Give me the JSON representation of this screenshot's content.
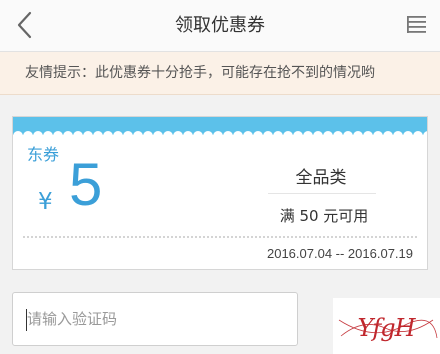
{
  "header": {
    "title": "领取优惠券",
    "back_icon": "chevron-left-icon",
    "menu_icon": "list-menu-icon"
  },
  "tip": {
    "text": "友情提示：此优惠券十分抢手，可能存在抢不到的情况哟"
  },
  "coupon": {
    "brand": "东券",
    "currency": "¥",
    "amount": "5",
    "category": "全品类",
    "condition": "满 50 元可用",
    "validity": "2016.07.04 -- 2016.07.19",
    "accent_color": "#3b9fd8",
    "top_band_color": "#5cc1ea"
  },
  "captcha": {
    "placeholder": "请输入验证码",
    "code_text": "YfgH",
    "code_color": "#c0272d"
  }
}
